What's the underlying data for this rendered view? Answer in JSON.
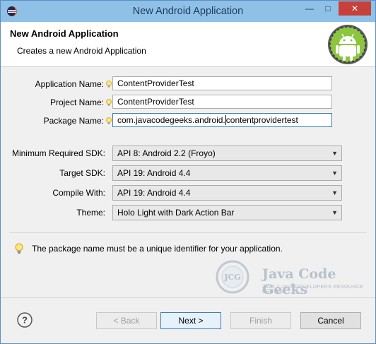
{
  "window": {
    "title": "New Android Application",
    "minimize_glyph": "—",
    "maximize_glyph": "□",
    "close_glyph": "✕",
    "icon": "eclipse-icon"
  },
  "header": {
    "title": "New Android Application",
    "description": "Creates a new Android Application",
    "logo": "android-logo-icon"
  },
  "form": {
    "application_name": {
      "label": "Application Name:",
      "value": "ContentProviderTest"
    },
    "project_name": {
      "label": "Project Name:",
      "value": "ContentProviderTest"
    },
    "package_name": {
      "label": "Package Name:",
      "value_before_caret": "com.javacodegeeks.android.",
      "value_after_caret": "contentprovidertest"
    }
  },
  "sdk": {
    "minimum": {
      "label": "Minimum Required SDK:",
      "value": "API 8: Android 2.2 (Froyo)"
    },
    "target": {
      "label": "Target SDK:",
      "value": "API 19: Android 4.4"
    },
    "compile": {
      "label": "Compile With:",
      "value": "API 19: Android 4.4"
    },
    "theme": {
      "label": "Theme:",
      "value": "Holo Light with Dark Action Bar"
    }
  },
  "info": {
    "message": "The package name must be a unique identifier for your application.",
    "icon": "lightbulb-icon"
  },
  "watermark": {
    "badge": "JCG",
    "title": "Java Code Geeks",
    "subtitle": "JAVA 2 JAVA DEVELOPERS RESOURCE CENTER"
  },
  "buttons": {
    "help_glyph": "?",
    "back": "< Back",
    "next": "Next >",
    "finish": "Finish",
    "cancel": "Cancel"
  },
  "colors": {
    "titlebar": "#8fc1e8",
    "close": "#c7413a",
    "focus_border": "#3c7fb1",
    "android_green": "#8cc63f"
  }
}
